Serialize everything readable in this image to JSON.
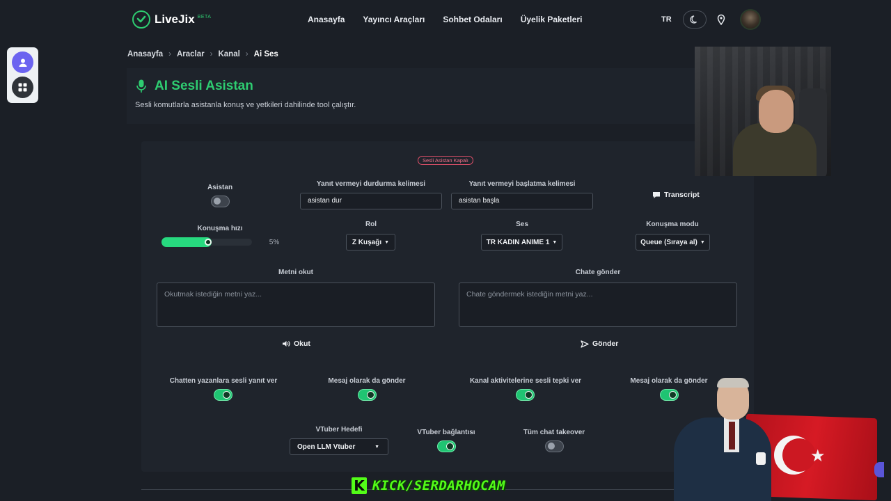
{
  "nav": {
    "logo_text": "LiveJix",
    "logo_badge": "BETA",
    "links": [
      "Anasayfa",
      "Yayıncı Araçları",
      "Sohbet Odaları",
      "Üyelik Paketleri"
    ],
    "lang": "TR"
  },
  "breadcrumb": [
    "Anasayfa",
    "Araclar",
    "Kanal",
    "Ai Ses"
  ],
  "header": {
    "title": "AI Sesli Asistan",
    "subtitle": "Sesli komutlarla asistanla konuş ve yetkileri dahilinde tool çalıştır."
  },
  "status_badge": "Sesli Asistan Kapalı",
  "row1": {
    "assistant_label": "Asistan",
    "stop_word_label": "Yanıt vermeyi durdurma kelimesi",
    "stop_word_value": "asistan dur",
    "start_word_label": "Yanıt vermeyi başlatma kelimesi",
    "start_word_value": "asistan başla",
    "transcript_label": "Transcript"
  },
  "row2": {
    "speed_label": "Konuşma hızı",
    "speed_value": "5%",
    "speed_fraction": 0.55,
    "role_label": "Rol",
    "role_value": "Z Kuşağı",
    "voice_label": "Ses",
    "voice_value": "TR KADIN ANIME 1",
    "mode_label": "Konuşma modu",
    "mode_value": "Queue (Sıraya al)"
  },
  "read": {
    "label": "Metni okut",
    "placeholder": "Okutmak istediğin metni yaz...",
    "button": "Okut"
  },
  "chat": {
    "label": "Chate gönder",
    "placeholder": "Chate göndermek istediğin metni yaz...",
    "button": "Gönder"
  },
  "toggles": [
    {
      "label": "Chatten yazanlara sesli yanıt ver",
      "on": true
    },
    {
      "label": "Mesaj olarak da gönder",
      "on": true
    },
    {
      "label": "Kanal aktivitelerine sesli tepki ver",
      "on": true
    },
    {
      "label": "Mesaj olarak da gönder",
      "on": true
    }
  ],
  "vtuber": {
    "target_label": "VTuber Hedefi",
    "target_value": "Open LLM Vtuber",
    "connection_label": "VTuber bağlantısı",
    "connection_on": true,
    "takeover_label": "Tüm chat takeover",
    "takeover_on": false
  },
  "overlay": {
    "kick_text": "KICK/SERDARHOCAM"
  },
  "colors": {
    "accent": "#2ecc71",
    "toggle_on": "#1fc472",
    "badge": "#e0506a",
    "kick": "#53fc18"
  }
}
